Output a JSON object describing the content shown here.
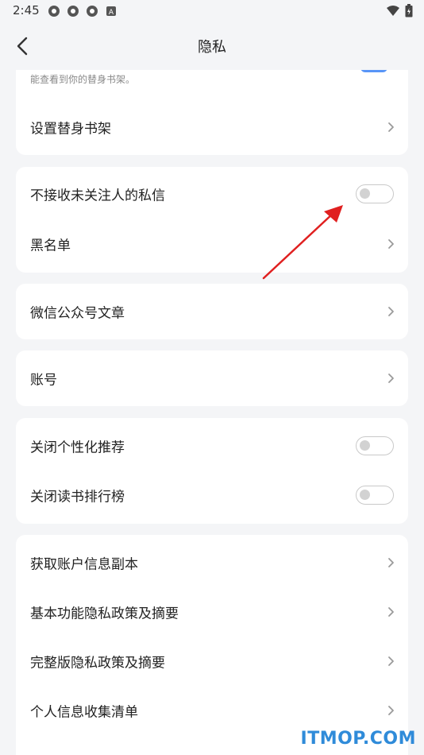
{
  "status_bar": {
    "time": "2:45",
    "icons": [
      "app-notification-icon",
      "app-notification-icon",
      "app-notification-icon",
      "keyboard-icon",
      "wifi-icon",
      "battery-icon"
    ]
  },
  "nav": {
    "title": "隐私"
  },
  "card1": {
    "partial_description": "能查看到你的替身书架。",
    "row_label": "设置替身书架"
  },
  "card2": {
    "rows": [
      {
        "label": "不接收未关注人的私信",
        "type": "toggle",
        "on": false
      },
      {
        "label": "黑名单",
        "type": "link"
      }
    ]
  },
  "card3": {
    "row_label": "微信公众号文章"
  },
  "card4": {
    "row_label": "账号"
  },
  "card5": {
    "rows": [
      {
        "label": "关闭个性化推荐",
        "type": "toggle",
        "on": false
      },
      {
        "label": "关闭读书排行榜",
        "type": "toggle",
        "on": false
      }
    ]
  },
  "card6": {
    "rows": [
      {
        "label": "获取账户信息副本",
        "type": "link"
      },
      {
        "label": "基本功能隐私政策及摘要",
        "type": "link"
      },
      {
        "label": "完整版隐私政策及摘要",
        "type": "link"
      },
      {
        "label": "个人信息收集清单",
        "type": "link"
      }
    ]
  },
  "annotation": {
    "arrow_color": "#e02020"
  },
  "watermark": {
    "text": "ITMOP.COM"
  }
}
